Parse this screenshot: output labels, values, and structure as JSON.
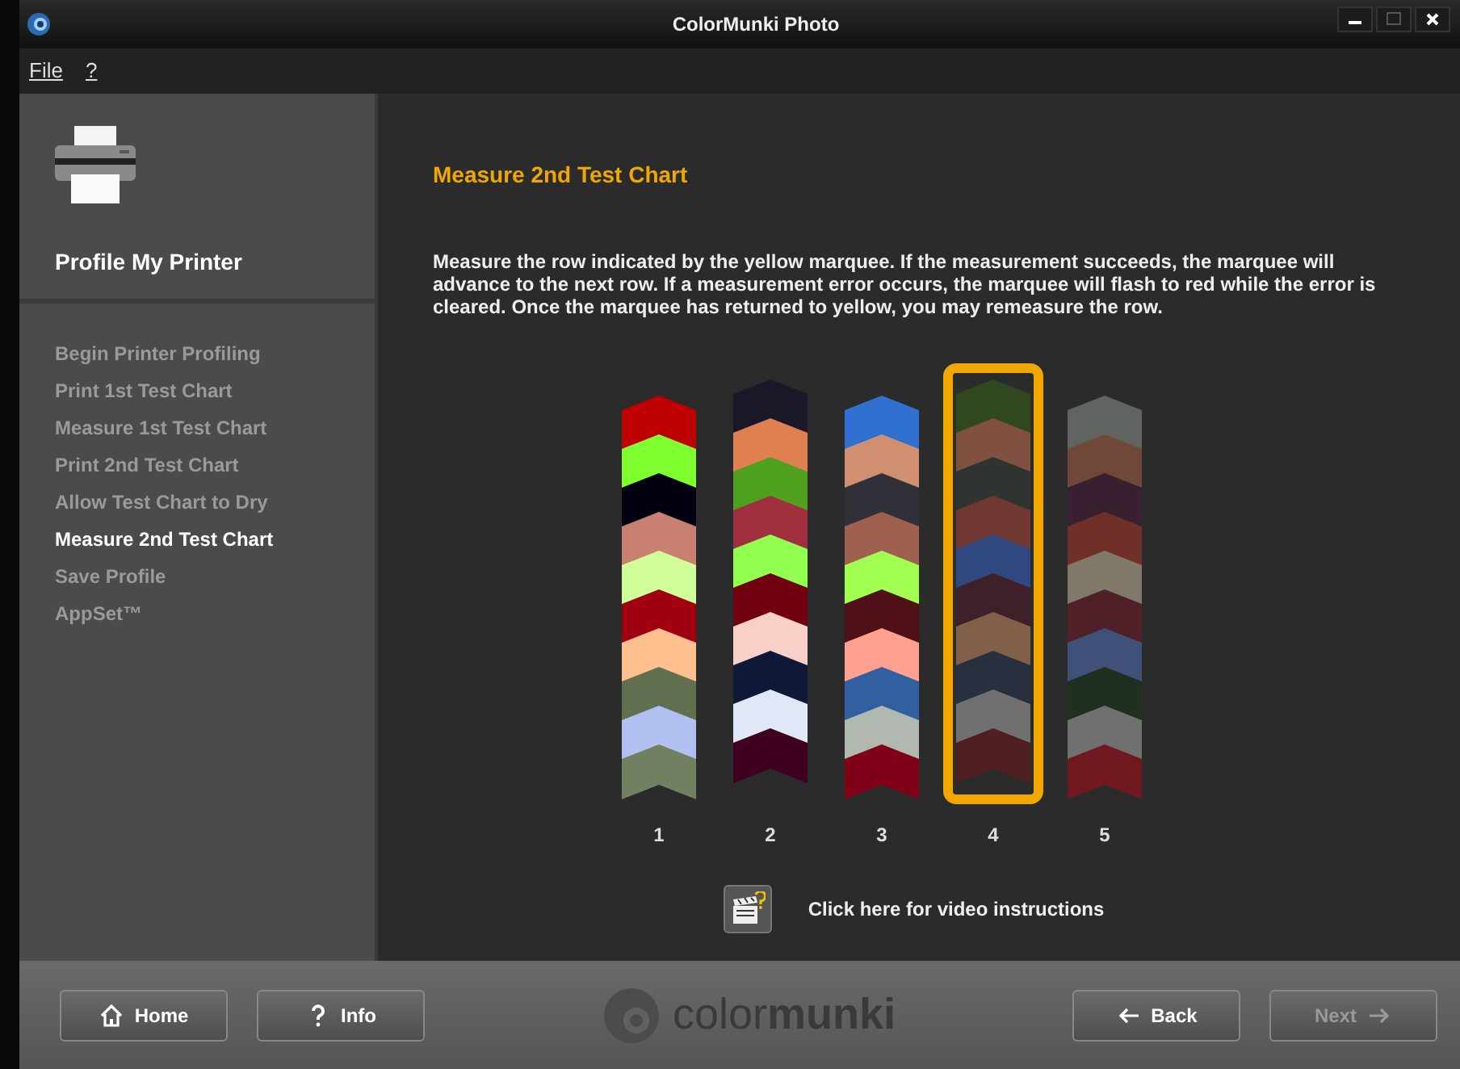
{
  "window": {
    "title": "ColorMunki Photo"
  },
  "menu": [
    "File",
    "?"
  ],
  "sidebar": {
    "title": "Profile My Printer",
    "items": [
      {
        "label": "Begin Printer Profiling",
        "selected": false
      },
      {
        "label": "Print 1st Test Chart",
        "selected": false
      },
      {
        "label": "Measure 1st Test Chart",
        "selected": false
      },
      {
        "label": "Print 2nd Test Chart",
        "selected": false
      },
      {
        "label": "Allow Test Chart to Dry",
        "selected": false
      },
      {
        "label": "Measure 2nd Test Chart",
        "selected": true
      },
      {
        "label": "Save Profile",
        "selected": false
      },
      {
        "label": "AppSet™",
        "selected": false
      }
    ]
  },
  "main": {
    "title": "Measure 2nd Test Chart",
    "instructions": "Measure the row indicated by the yellow marquee.  If the measurement succeeds, the marquee will advance to the next row.  If a measurement error occurs, the marquee will flash to red while the error is cleared.  Once the marquee has returned to yellow, you may remeasure the row.",
    "rows": [
      {
        "label": "1",
        "selected": false,
        "patches": [
          {
            "color": "#c00000"
          },
          {
            "color": "#80ff30"
          },
          {
            "color": "#000010"
          },
          {
            "color": "#c88070"
          },
          {
            "color": "#d0ff9a"
          },
          {
            "color": "#a00010"
          },
          {
            "color": "#ffc090"
          },
          {
            "color": "#607050"
          },
          {
            "color": "#b0c0f0"
          },
          {
            "color": "#708060"
          }
        ]
      },
      {
        "label": "2",
        "selected": false,
        "patches": [
          {
            "color": "#181828"
          },
          {
            "color": "#e08050"
          },
          {
            "color": "#50a020"
          },
          {
            "color": "#a03040"
          },
          {
            "color": "#90ff50"
          },
          {
            "color": "#700010"
          },
          {
            "color": "#f8d0c8"
          },
          {
            "color": "#101838"
          },
          {
            "color": "#e0e8f8"
          },
          {
            "color": "#400020"
          }
        ]
      },
      {
        "label": "3",
        "selected": false,
        "patches": [
          {
            "color": "#3070d0"
          },
          {
            "color": "#d09070"
          },
          {
            "color": "#303038"
          },
          {
            "color": "#a06050"
          },
          {
            "color": "#a0ff50"
          },
          {
            "color": "#501018"
          },
          {
            "color": "#ffa090"
          },
          {
            "color": "#3060a0"
          },
          {
            "color": "#b0b8b0"
          },
          {
            "color": "#800018"
          }
        ]
      },
      {
        "label": "4",
        "selected": true,
        "patches": [
          {
            "color": "#304820"
          },
          {
            "color": "#805040"
          },
          {
            "color": "#303430"
          },
          {
            "color": "#703830"
          },
          {
            "color": "#304880"
          },
          {
            "color": "#402028"
          },
          {
            "color": "#806048"
          },
          {
            "color": "#283040"
          },
          {
            "color": "#707070"
          },
          {
            "color": "#502020"
          }
        ]
      },
      {
        "label": "5",
        "selected": false,
        "patches": [
          {
            "color": "#606460"
          },
          {
            "color": "#704838"
          },
          {
            "color": "#382030"
          },
          {
            "color": "#703028"
          },
          {
            "color": "#807868"
          },
          {
            "color": "#502028"
          },
          {
            "color": "#405078"
          },
          {
            "color": "#203020"
          },
          {
            "color": "#707070"
          },
          {
            "color": "#701820"
          }
        ]
      }
    ],
    "video_link": "Click here for video instructions"
  },
  "footer": {
    "buttons": [
      {
        "label": "Home",
        "kind": "home",
        "disabled": false
      },
      {
        "label": "Info",
        "kind": "info",
        "disabled": false
      }
    ],
    "logo": "color**munki**",
    "nav": [
      {
        "label": "Back",
        "kind": "back",
        "disabled": false
      },
      {
        "label": "Next",
        "kind": "next",
        "disabled": true
      }
    ]
  }
}
